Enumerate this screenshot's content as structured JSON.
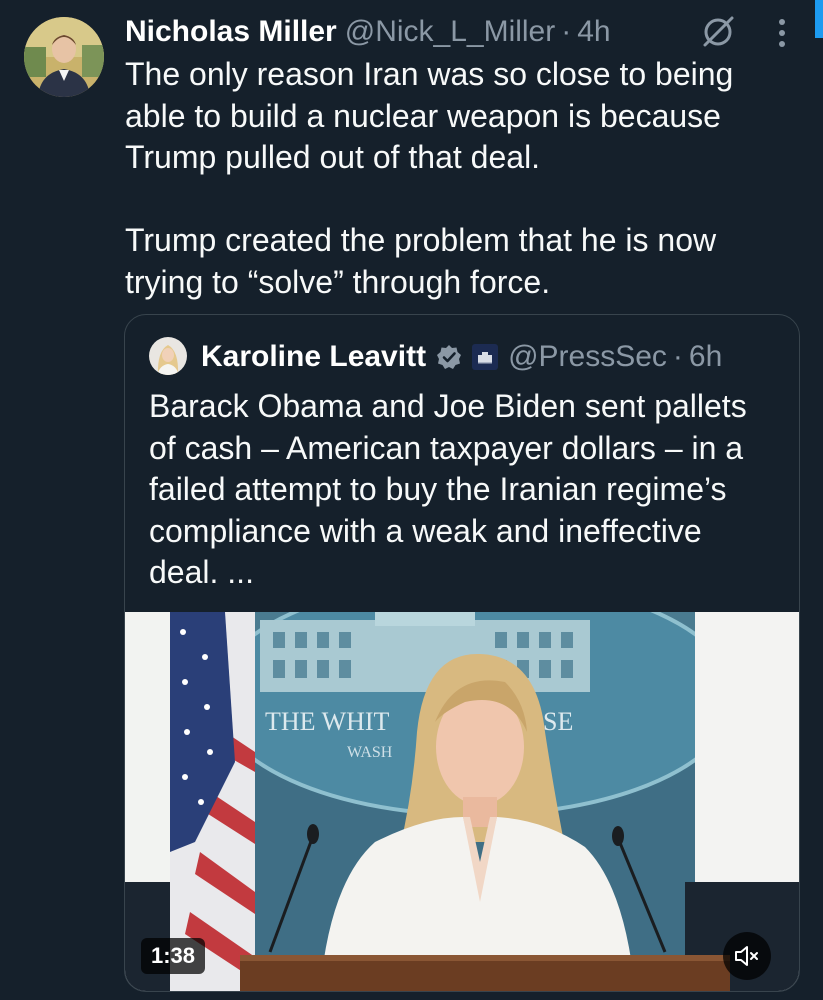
{
  "tweet": {
    "author_name": "Nicholas Miller",
    "handle": "@Nick_L_Miller",
    "separator": "·",
    "time": "4h",
    "paragraphs": [
      "The only reason Iran was so close to being able to build a nuclear weapon is because Trump pulled out of that deal.",
      "Trump created the problem that he is now trying to “solve” through force."
    ]
  },
  "quote": {
    "author_name": "Karoline Leavitt",
    "handle": "@PressSec",
    "separator": "·",
    "time": "6h",
    "text": "Barack Obama and Joe Biden sent pallets of cash – American taxpayer dollars – in a failed attempt to buy the Iranian regime’s compliance with a weak and ineffective deal. ...",
    "video": {
      "duration": "1:38",
      "backdrop_text": "THE WHIT",
      "backdrop_text_2": "SE",
      "backdrop_subtext": "WASH"
    }
  },
  "icons": [
    "avatar",
    "grok-icon",
    "more-icon",
    "verified-icon",
    "white-house-badge-icon",
    "mute-icon"
  ],
  "colors": {
    "background": "#15202b",
    "text": "#f7f9f9",
    "secondary_text": "#8b98a5",
    "border": "#38444d",
    "verified": "#8b98a5",
    "accent": "#1d9bf0"
  }
}
